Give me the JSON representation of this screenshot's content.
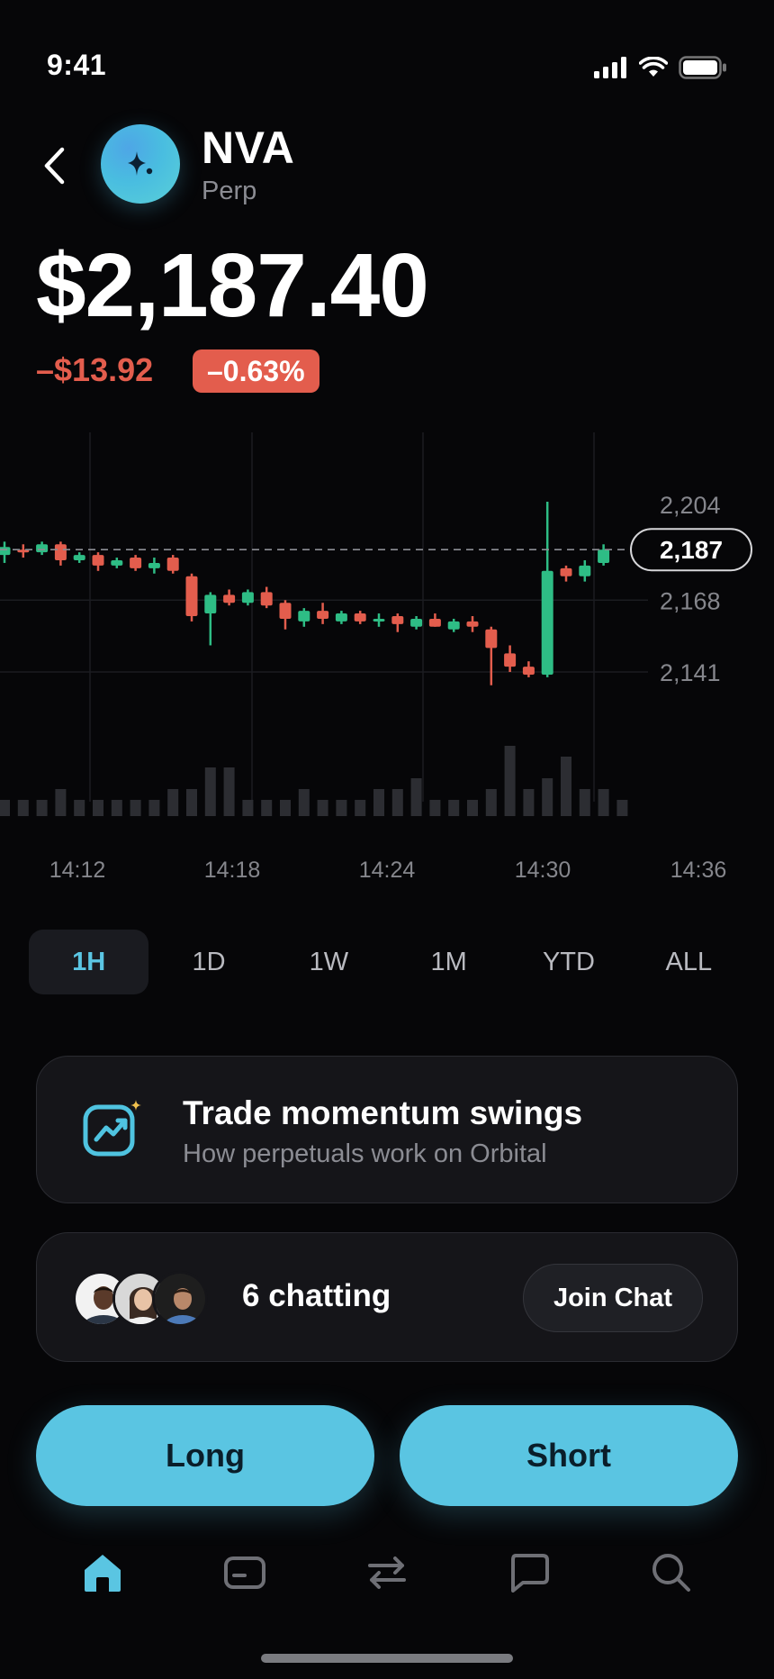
{
  "status_bar": {
    "time": "9:41"
  },
  "header": {
    "ticker": "NVA",
    "market_type": "Perp"
  },
  "price": {
    "current": "$2,187.40",
    "change_abs": "–$13.92",
    "change_pct": "–0.63%"
  },
  "colors": {
    "up": "#2ebd85",
    "down": "#e35d4d",
    "accent": "#5ac5e2",
    "background": "#060608"
  },
  "chart_data": {
    "type": "candlestick",
    "x_ticks": [
      "14:12",
      "14:18",
      "14:24",
      "14:30",
      "14:36"
    ],
    "y_ticks": [
      2204,
      2168,
      2141
    ],
    "current_price_label": "2,187",
    "current_price": 2187,
    "candles": [
      {
        "o": 2185,
        "h": 2190,
        "l": 2182,
        "c": 2188
      },
      {
        "o": 2187,
        "h": 2189,
        "l": 2184,
        "c": 2186
      },
      {
        "o": 2186,
        "h": 2190,
        "l": 2185,
        "c": 2189
      },
      {
        "o": 2189,
        "h": 2190,
        "l": 2181,
        "c": 2183
      },
      {
        "o": 2183,
        "h": 2186,
        "l": 2182,
        "c": 2185
      },
      {
        "o": 2185,
        "h": 2186,
        "l": 2179,
        "c": 2181
      },
      {
        "o": 2181,
        "h": 2184,
        "l": 2180,
        "c": 2183
      },
      {
        "o": 2184,
        "h": 2185,
        "l": 2179,
        "c": 2180
      },
      {
        "o": 2180,
        "h": 2184,
        "l": 2178,
        "c": 2182
      },
      {
        "o": 2184,
        "h": 2185,
        "l": 2178,
        "c": 2179
      },
      {
        "o": 2177,
        "h": 2178,
        "l": 2160,
        "c": 2162
      },
      {
        "o": 2163,
        "h": 2171,
        "l": 2151,
        "c": 2170
      },
      {
        "o": 2170,
        "h": 2172,
        "l": 2166,
        "c": 2167
      },
      {
        "o": 2167,
        "h": 2172,
        "l": 2166,
        "c": 2171
      },
      {
        "o": 2171,
        "h": 2173,
        "l": 2165,
        "c": 2166
      },
      {
        "o": 2167,
        "h": 2168,
        "l": 2157,
        "c": 2161
      },
      {
        "o": 2160,
        "h": 2165,
        "l": 2158,
        "c": 2164
      },
      {
        "o": 2164,
        "h": 2167,
        "l": 2159,
        "c": 2161
      },
      {
        "o": 2160,
        "h": 2164,
        "l": 2159,
        "c": 2163
      },
      {
        "o": 2163,
        "h": 2164,
        "l": 2159,
        "c": 2160
      },
      {
        "o": 2160,
        "h": 2163,
        "l": 2158,
        "c": 2161
      },
      {
        "o": 2162,
        "h": 2163,
        "l": 2156,
        "c": 2159
      },
      {
        "o": 2158,
        "h": 2162,
        "l": 2157,
        "c": 2161
      },
      {
        "o": 2161,
        "h": 2163,
        "l": 2158,
        "c": 2158
      },
      {
        "o": 2157,
        "h": 2161,
        "l": 2156,
        "c": 2160
      },
      {
        "o": 2160,
        "h": 2162,
        "l": 2156,
        "c": 2158
      },
      {
        "o": 2157,
        "h": 2158,
        "l": 2136,
        "c": 2150
      },
      {
        "o": 2148,
        "h": 2151,
        "l": 2141,
        "c": 2143
      },
      {
        "o": 2143,
        "h": 2145,
        "l": 2139,
        "c": 2140
      },
      {
        "o": 2140,
        "h": 2205,
        "l": 2139,
        "c": 2179
      },
      {
        "o": 2180,
        "h": 2181,
        "l": 2175,
        "c": 2177
      },
      {
        "o": 2177,
        "h": 2183,
        "l": 2175,
        "c": 2181
      },
      {
        "o": 2182,
        "h": 2189,
        "l": 2181,
        "c": 2187
      }
    ],
    "volumes": [
      1,
      1,
      1,
      2,
      1,
      1,
      1,
      1,
      1,
      2,
      2,
      4,
      4,
      1,
      1,
      1,
      2,
      1,
      1,
      1,
      2,
      2,
      3,
      1,
      1,
      1,
      2,
      6,
      2,
      3,
      5,
      2,
      2,
      1
    ]
  },
  "timeframes": {
    "items": [
      "1H",
      "1D",
      "1W",
      "1M",
      "YTD",
      "ALL"
    ],
    "active": "1H"
  },
  "learn_card": {
    "title": "Trade momentum swings",
    "subtitle": "How perpetuals work on Orbital"
  },
  "chat_card": {
    "count_label": "6 chatting",
    "join_label": "Join Chat"
  },
  "actions": {
    "long_label": "Long",
    "short_label": "Short"
  },
  "nav": {
    "items": [
      "home-icon",
      "wallet-icon",
      "swap-icon",
      "chat-icon",
      "search-icon"
    ],
    "active": "home-icon"
  }
}
